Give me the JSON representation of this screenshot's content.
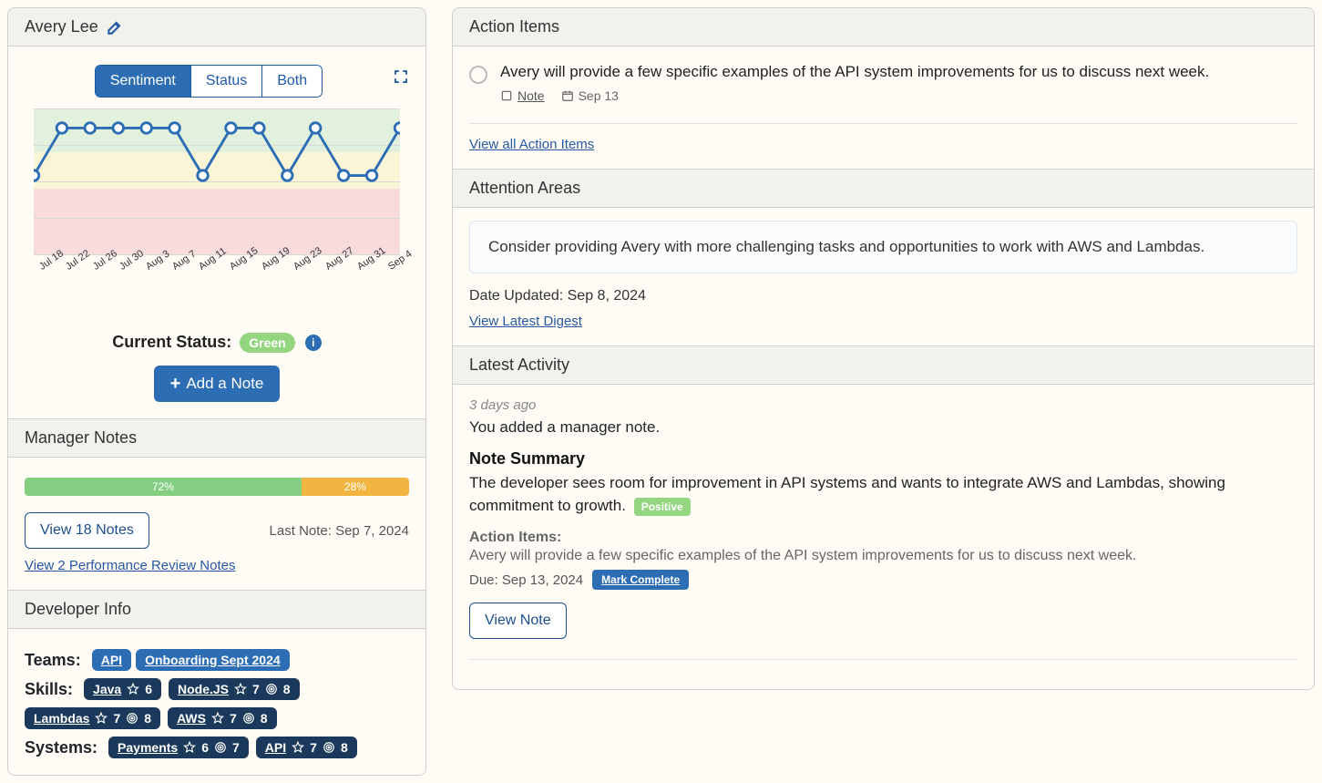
{
  "left": {
    "name": "Avery Lee",
    "toggle": {
      "sentiment": "Sentiment",
      "status": "Status",
      "both": "Both"
    },
    "current_status_label": "Current Status:",
    "status_badge": "Green",
    "add_note_label": "Add a Note",
    "manager_notes": {
      "header": "Manager Notes",
      "pct_green": "72%",
      "pct_yellow": "28%",
      "view_notes_label": "View 18 Notes",
      "last_note_label": "Last Note: Sep 7, 2024",
      "view_reviews_label": "View 2 Performance Review Notes"
    },
    "developer_info": {
      "header": "Developer Info",
      "teams_label": "Teams:",
      "teams": [
        {
          "name": "API"
        },
        {
          "name": "Onboarding Sept 2024"
        }
      ],
      "skills_label": "Skills:",
      "skills": [
        {
          "name": "Java",
          "star": "6"
        },
        {
          "name": "Node.JS",
          "star": "7",
          "target": "8"
        },
        {
          "name": "Lambdas",
          "star": "7",
          "target": "8"
        },
        {
          "name": "AWS",
          "star": "7",
          "target": "8"
        }
      ],
      "systems_label": "Systems:",
      "systems": [
        {
          "name": "Payments",
          "star": "6",
          "target": "7"
        },
        {
          "name": "API",
          "star": "7",
          "target": "8"
        }
      ]
    }
  },
  "right": {
    "action_items": {
      "header": "Action Items",
      "item_text": "Avery will provide a few specific examples of the API system improvements for us to discuss next week.",
      "note_label": "Note",
      "date_label": "Sep 13",
      "view_all_label": "View all Action Items"
    },
    "attention": {
      "header": "Attention Areas",
      "text": "Consider providing Avery with more challenging tasks and opportunities to work with AWS and Lambdas.",
      "date_updated": "Date Updated: Sep 8, 2024",
      "view_digest_label": "View Latest Digest"
    },
    "latest_activity": {
      "header": "Latest Activity",
      "age": "3 days ago",
      "line": "You added a manager note.",
      "summary_label": "Note Summary",
      "summary_text": "The developer sees room for improvement in API systems and wants to integrate AWS and Lambdas, showing commitment to growth.",
      "positive_badge": "Positive",
      "action_items_label": "Action Items:",
      "action_items_text": "Avery will provide a few specific examples of the API system improvements for us to discuss next week.",
      "due_label": "Due: Sep 13, 2024",
      "mark_complete_label": "Mark Complete",
      "view_note_label": "View Note"
    }
  },
  "chart_data": {
    "type": "line",
    "title": "",
    "xlabel": "",
    "ylabel": "",
    "ylim": [
      0,
      3
    ],
    "categories": [
      "Jul 18",
      "Jul 22",
      "Jul 26",
      "Jul 30",
      "Aug 3",
      "Aug 7",
      "Aug 11",
      "Aug 15",
      "Aug 19",
      "Aug 23",
      "Aug 27",
      "Aug 31",
      "Sep 4"
    ],
    "series": [
      {
        "name": "Sentiment",
        "values": [
          2,
          3,
          3,
          3,
          3,
          3,
          2,
          3,
          3,
          2,
          3,
          2,
          2,
          3
        ],
        "note": "3=Green band, 2=Yellow band, 1=Red band; extra trailing point sits between last two labels"
      }
    ],
    "bands": [
      {
        "name": "green",
        "range": [
          2.5,
          3
        ]
      },
      {
        "name": "yellow",
        "range": [
          1.7,
          2.5
        ]
      },
      {
        "name": "red",
        "range": [
          0,
          1.7
        ]
      }
    ]
  }
}
